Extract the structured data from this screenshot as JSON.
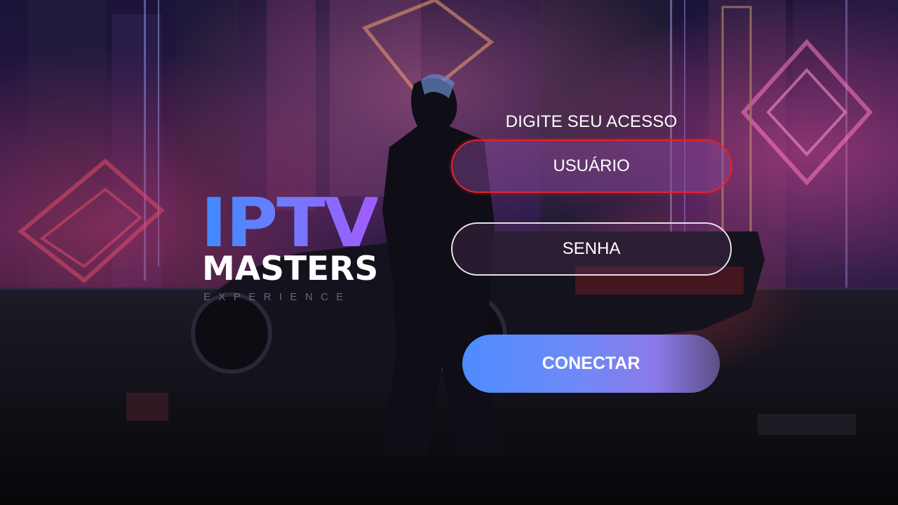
{
  "logo": {
    "line1": "IPTV",
    "line2": "MASTERS",
    "line3": "EXPERIENCE"
  },
  "form": {
    "title": "DIGITE SEU ACESSO",
    "username_placeholder": "USUÁRIO",
    "password_placeholder": "SENHA",
    "connect_label": "CONECTAR"
  },
  "colors": {
    "focus_border": "#e0242e",
    "button_gradient_start": "#4d8cff",
    "button_gradient_end": "#5d4f86",
    "logo_gradient_start": "#3d8bff",
    "logo_gradient_end": "#a25bff"
  }
}
